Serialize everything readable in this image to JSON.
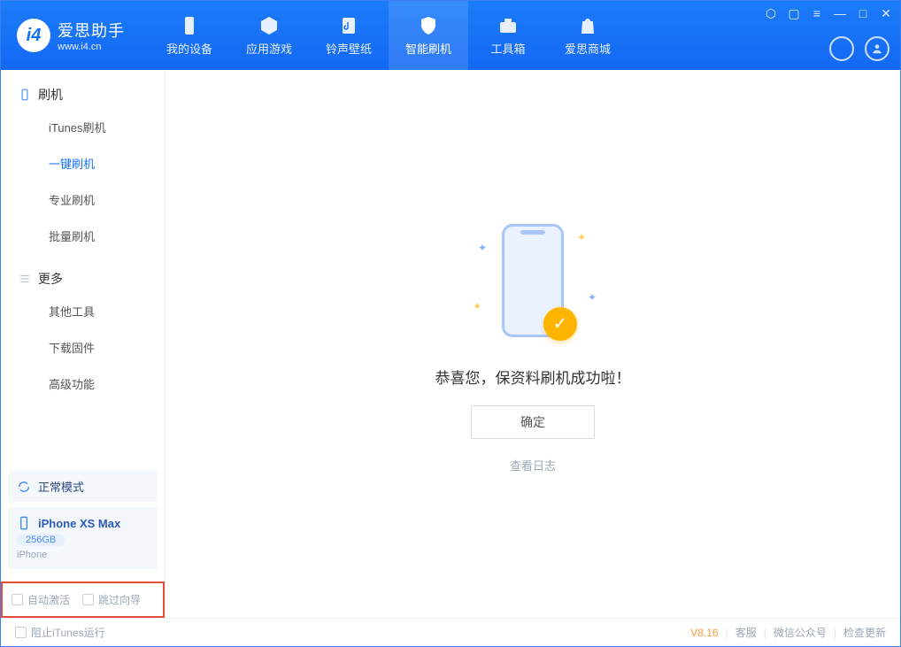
{
  "brand": {
    "name": "爱思助手",
    "url": "www.i4.cn"
  },
  "nav": {
    "items": [
      {
        "label": "我的设备"
      },
      {
        "label": "应用游戏"
      },
      {
        "label": "铃声壁纸"
      },
      {
        "label": "智能刷机"
      },
      {
        "label": "工具箱"
      },
      {
        "label": "爱思商城"
      }
    ]
  },
  "sidebar": {
    "section1": {
      "title": "刷机",
      "items": [
        "iTunes刷机",
        "一键刷机",
        "专业刷机",
        "批量刷机"
      ]
    },
    "section2": {
      "title": "更多",
      "items": [
        "其他工具",
        "下载固件",
        "高级功能"
      ]
    }
  },
  "device": {
    "mode": "正常模式",
    "name": "iPhone XS Max",
    "capacity": "256GB",
    "type": "iPhone"
  },
  "options": {
    "auto_activate": "自动激活",
    "skip_guide": "跳过向导"
  },
  "main": {
    "message": "恭喜您，保资料刷机成功啦！",
    "ok": "确定",
    "view_log": "查看日志"
  },
  "footer": {
    "block_itunes": "阻止iTunes运行",
    "version": "V8.16",
    "support": "客服",
    "wechat": "微信公众号",
    "check_update": "检查更新"
  }
}
